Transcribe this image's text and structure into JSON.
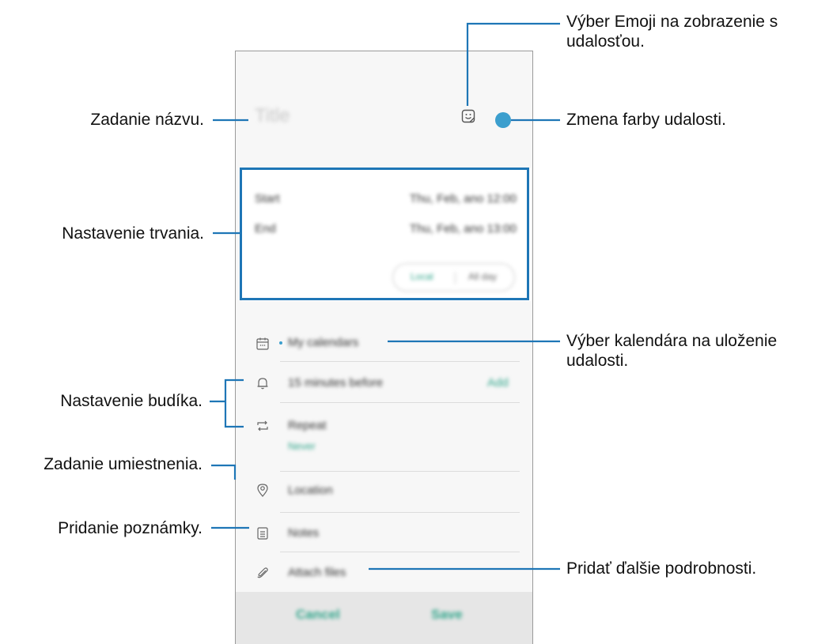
{
  "colors": {
    "callout_line": "#1e76b6",
    "event_color_dot": "#3c9fce",
    "accent_green": "#2fa58a"
  },
  "icons": {
    "emoji": "sticker-icon",
    "calendar": "calendar-icon",
    "alarm": "bell-icon",
    "repeat": "repeat-icon",
    "location": "location-pin-icon",
    "notes": "notes-icon",
    "attach": "paperclip-icon"
  },
  "event_form": {
    "title_placeholder": "Title",
    "duration": {
      "start_label": "Start",
      "start_value": "Thu, Feb, ano 12:00",
      "end_label": "End",
      "end_value": "Thu, Feb, ano 13:00",
      "tz_left": "Local",
      "tz_right": "All day"
    },
    "calendar_name": "My calendars",
    "alarm_text": "15 minutes before",
    "alarm_action": "Add",
    "repeat_title": "Repeat",
    "repeat_sub": "Never",
    "location_placeholder": "Location",
    "notes_placeholder": "Notes",
    "attach_text": "Attach files",
    "cancel_label": "Cancel",
    "save_label": "Save"
  },
  "annotations": {
    "emoji": "Výber Emoji na zobrazenie s\nudalosťou.",
    "title": "Zadanie názvu.",
    "color": "Zmena farby udalosti.",
    "duration": "Nastavenie trvania.",
    "calendar": "Výber kalendára na uloženie\nudalosti.",
    "alarm": "Nastavenie budíka.",
    "location": "Zadanie umiestnenia.",
    "note": "Pridanie poznámky.",
    "details": "Pridať ďalšie podrobnosti."
  }
}
